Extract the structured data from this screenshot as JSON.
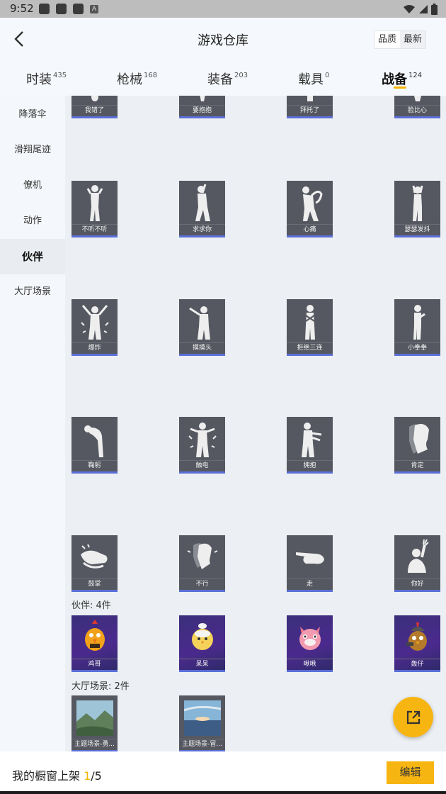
{
  "status_bar": {
    "time": "9:52",
    "notif_letter": "A"
  },
  "header": {
    "title": "游戏仓库",
    "sort": {
      "quality": "品质",
      "latest": "最新"
    }
  },
  "tabs": [
    {
      "label": "时装",
      "count": "435"
    },
    {
      "label": "枪械",
      "count": "168"
    },
    {
      "label": "装备",
      "count": "203"
    },
    {
      "label": "载具",
      "count": "0"
    },
    {
      "label": "战备",
      "count": "124"
    }
  ],
  "sidebar": {
    "items": [
      {
        "label": "降落伞"
      },
      {
        "label": "滑翔尾迹"
      },
      {
        "label": "僚机"
      },
      {
        "label": "动作"
      },
      {
        "label": "伙伴"
      },
      {
        "label": "大厅场景"
      }
    ]
  },
  "emotes": {
    "row0": [
      "我错了",
      "要抱抱",
      "拜托了",
      "脸比心"
    ],
    "row1": [
      "不听不听",
      "求求你",
      "心痛",
      "瑟瑟发抖"
    ],
    "row2": [
      "爆炸",
      "摸摸头",
      "拒绝三连",
      "小拳拳"
    ],
    "row3": [
      "鞠躬",
      "触电",
      "拥抱",
      "肯定"
    ],
    "row4": [
      "鼓掌",
      "不行",
      "走",
      "你好"
    ]
  },
  "partners": {
    "section_label": "伙伴: 4件",
    "items": [
      "鸡哥",
      "呆呆",
      "啾啾",
      "轰仔"
    ]
  },
  "scenes": {
    "section_label": "大厅场景: 2件",
    "items": [
      "主题场景-勇...",
      "主题场景-冒..."
    ]
  },
  "footer": {
    "prefix": "我的橱窗上架 ",
    "current": "1",
    "total": "/5",
    "edit_label": "编辑"
  },
  "colors": {
    "accent": "#f7b511",
    "card_bg": "#565861",
    "card_underline": "#5a6fd8"
  }
}
